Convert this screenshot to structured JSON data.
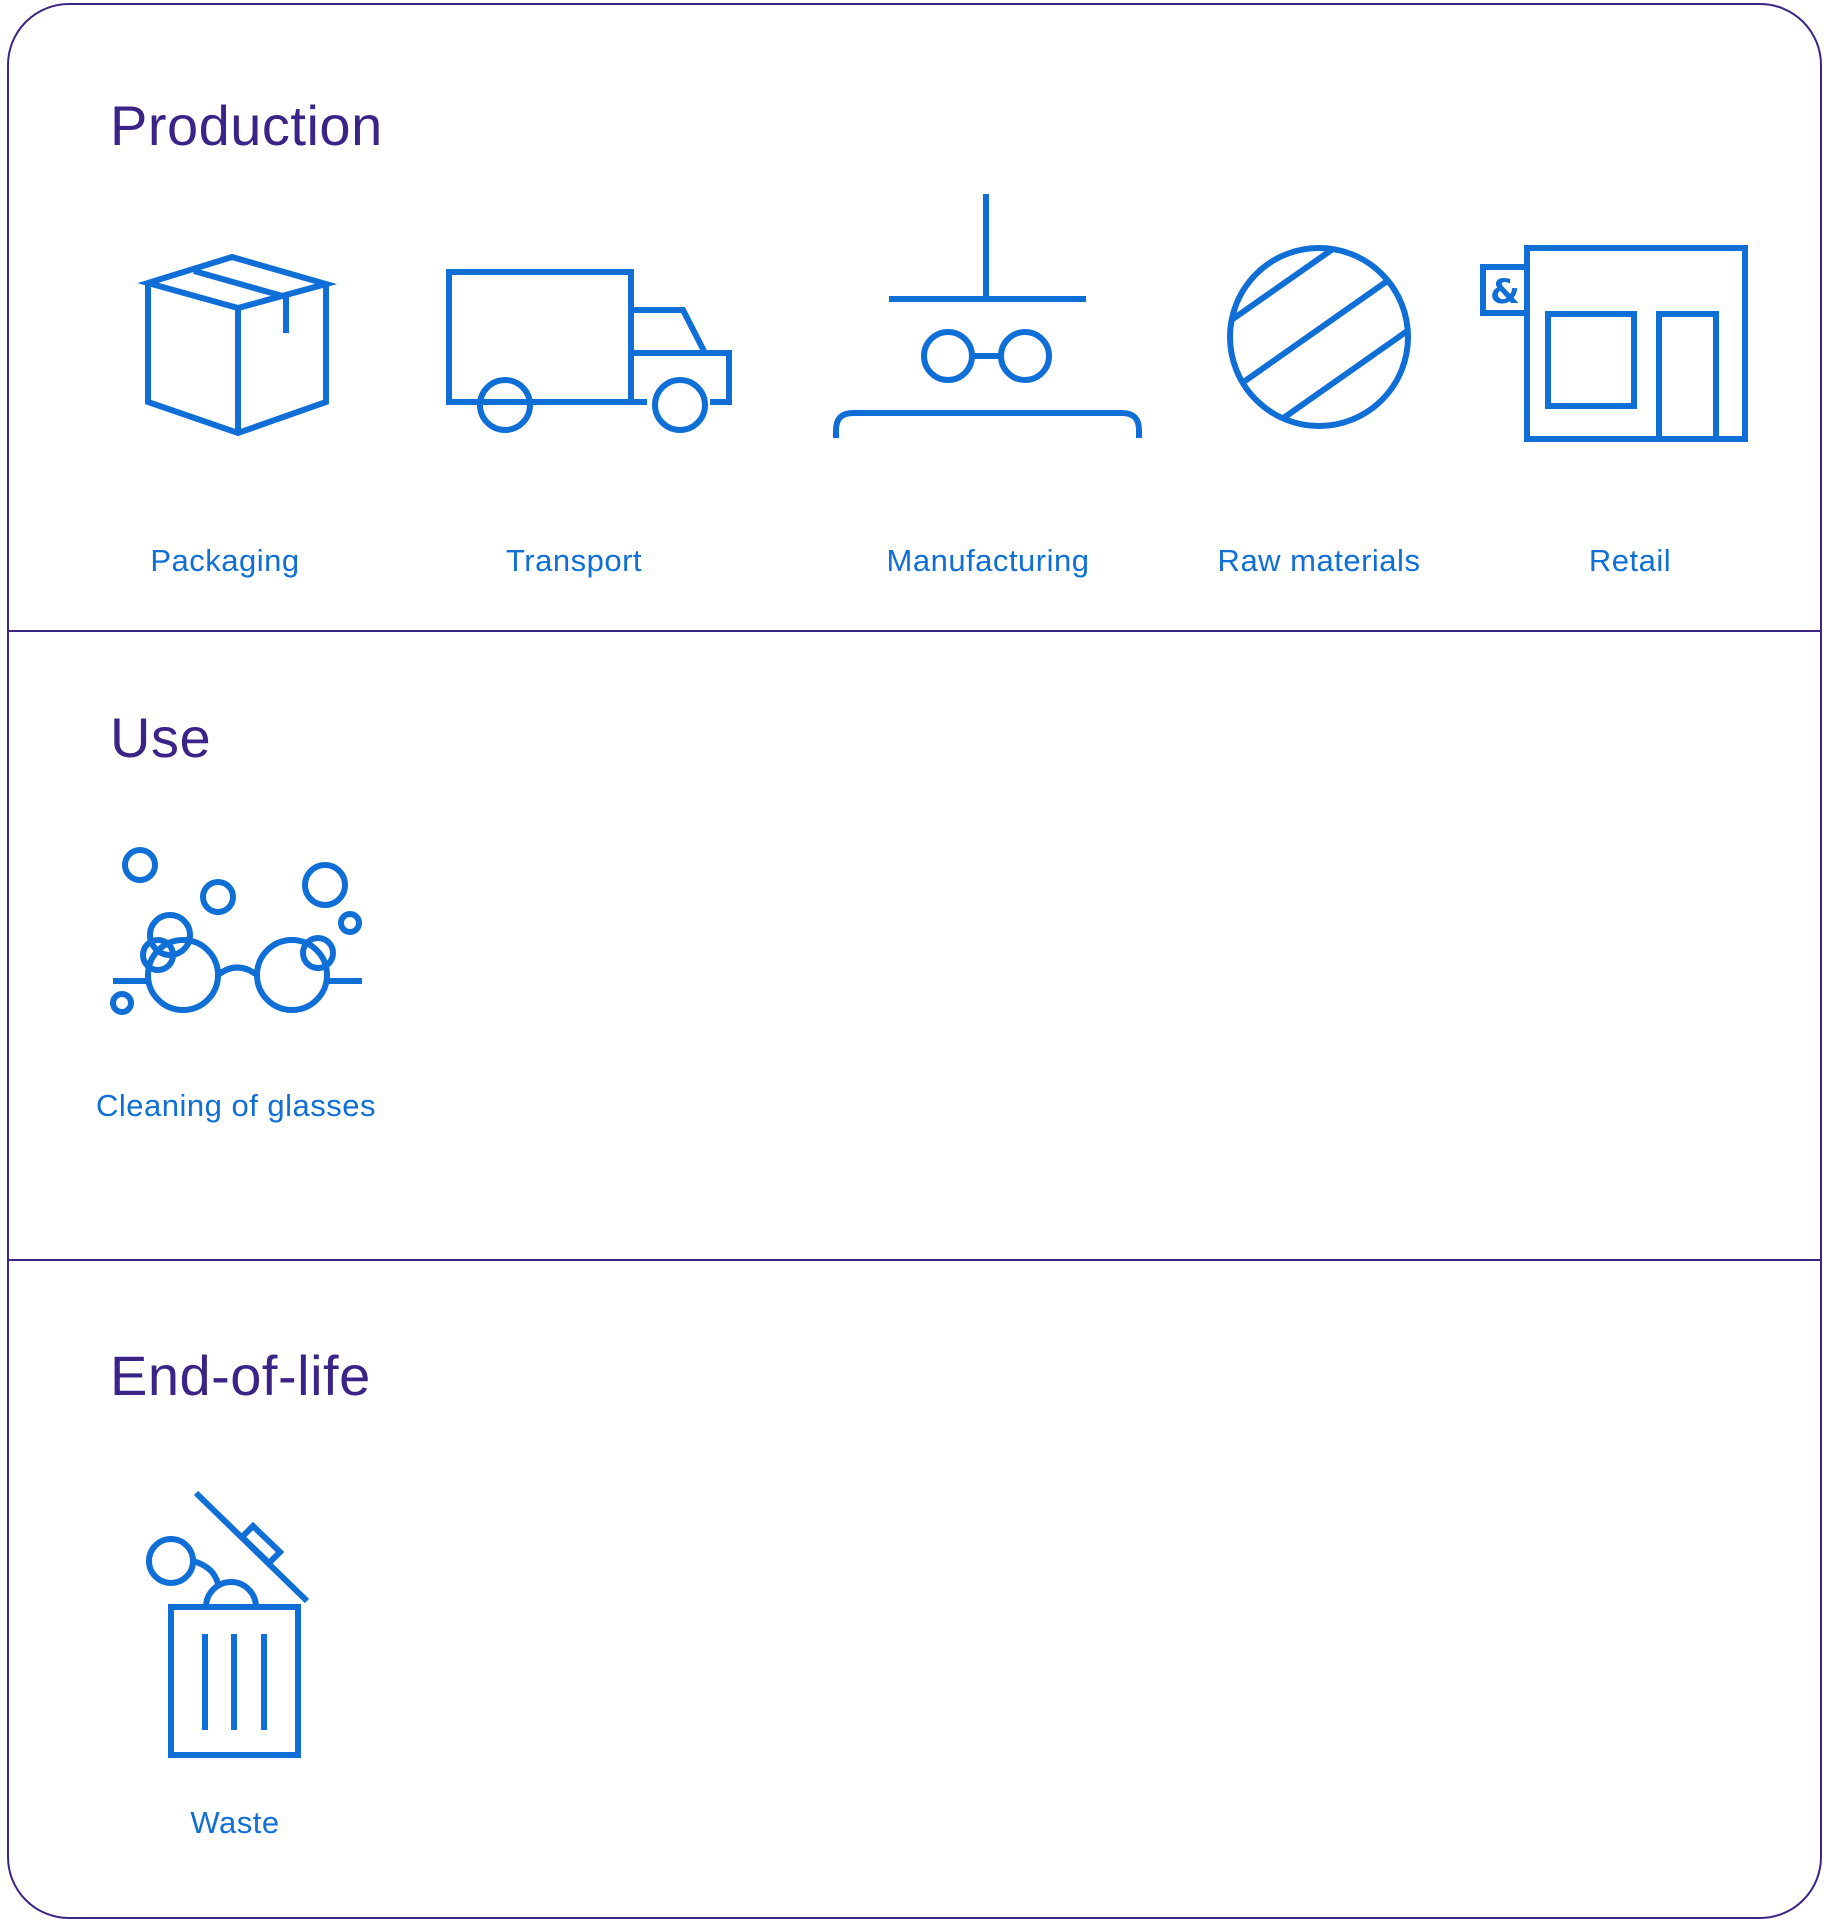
{
  "sections": [
    {
      "title": "Production",
      "items": [
        {
          "label": "Packaging",
          "icon": "box-icon"
        },
        {
          "label": "Transport",
          "icon": "truck-icon"
        },
        {
          "label": "Manufacturing",
          "icon": "manufacturing-icon"
        },
        {
          "label": "Raw materials",
          "icon": "raw-materials-icon"
        },
        {
          "label": "Retail",
          "icon": "store-icon"
        }
      ]
    },
    {
      "title": "Use",
      "items": [
        {
          "label": "Cleaning of glasses",
          "icon": "glasses-bubbles-icon"
        }
      ]
    },
    {
      "title": "End-of-life",
      "items": [
        {
          "label": "Waste",
          "icon": "trash-bin-icon"
        }
      ]
    }
  ],
  "store_sign": "&",
  "colors": {
    "border": "#3d2583",
    "title": "#3b2488",
    "icon": "#0f6fd6"
  }
}
